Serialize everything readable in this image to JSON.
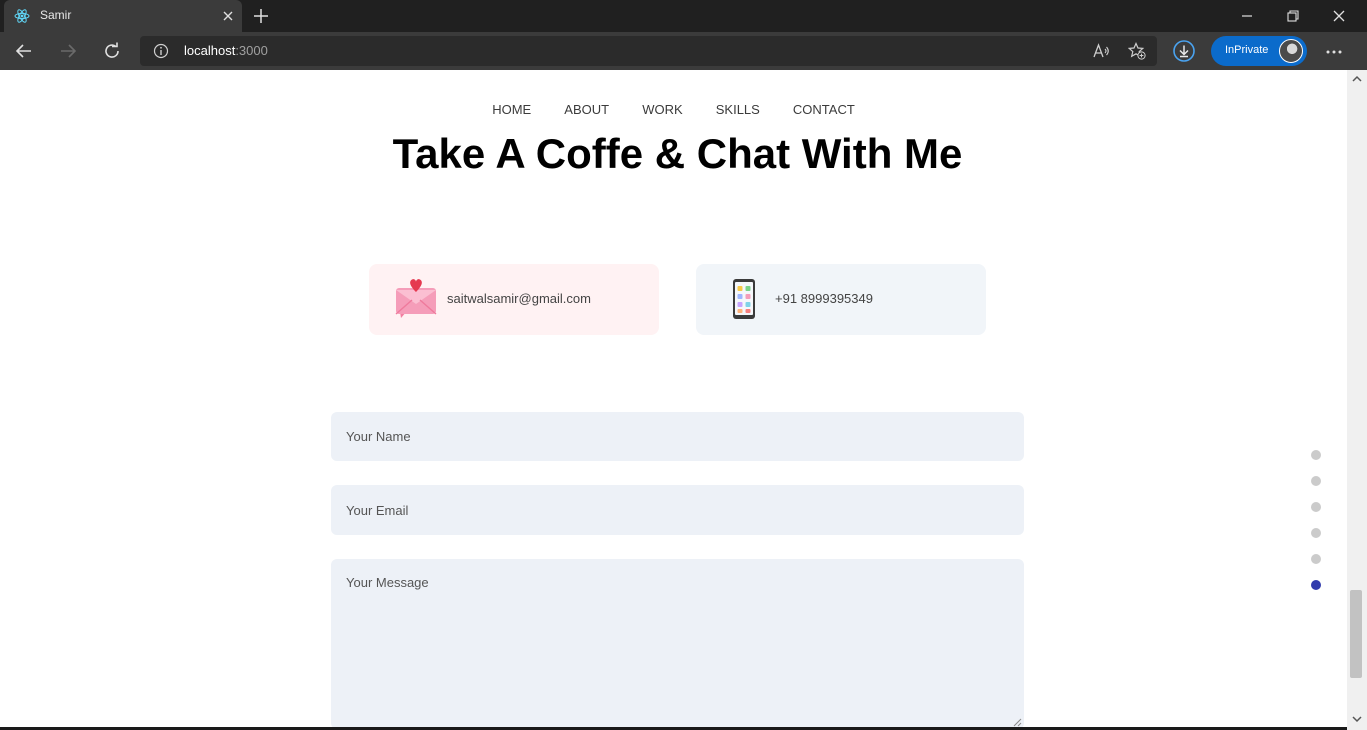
{
  "browser": {
    "tab_title": "Samir",
    "url_host": "localhost",
    "url_port": ":3000",
    "inprivate_label": "InPrivate"
  },
  "site": {
    "nav": [
      "HOME",
      "ABOUT",
      "WORK",
      "SKILLS",
      "CONTACT"
    ],
    "headline": "Take A Coffe & Chat With Me",
    "email": "saitwalsamir@gmail.com",
    "phone": "+91 8999395349",
    "form": {
      "name_placeholder": "Your Name",
      "email_placeholder": "Your Email",
      "message_placeholder": "Your Message"
    },
    "section_dots_active_index": 5
  },
  "colors": {
    "accent": "#313bac",
    "email_card_bg": "#fff2f3",
    "phone_card_bg": "#f1f5f9",
    "field_bg": "#edf1f7",
    "inprivate_bg": "#0b6bcb"
  },
  "icons": {
    "tab": "react-icon",
    "email_card": "envelope-heart-icon",
    "phone_card": "mobile-phone-icon"
  }
}
